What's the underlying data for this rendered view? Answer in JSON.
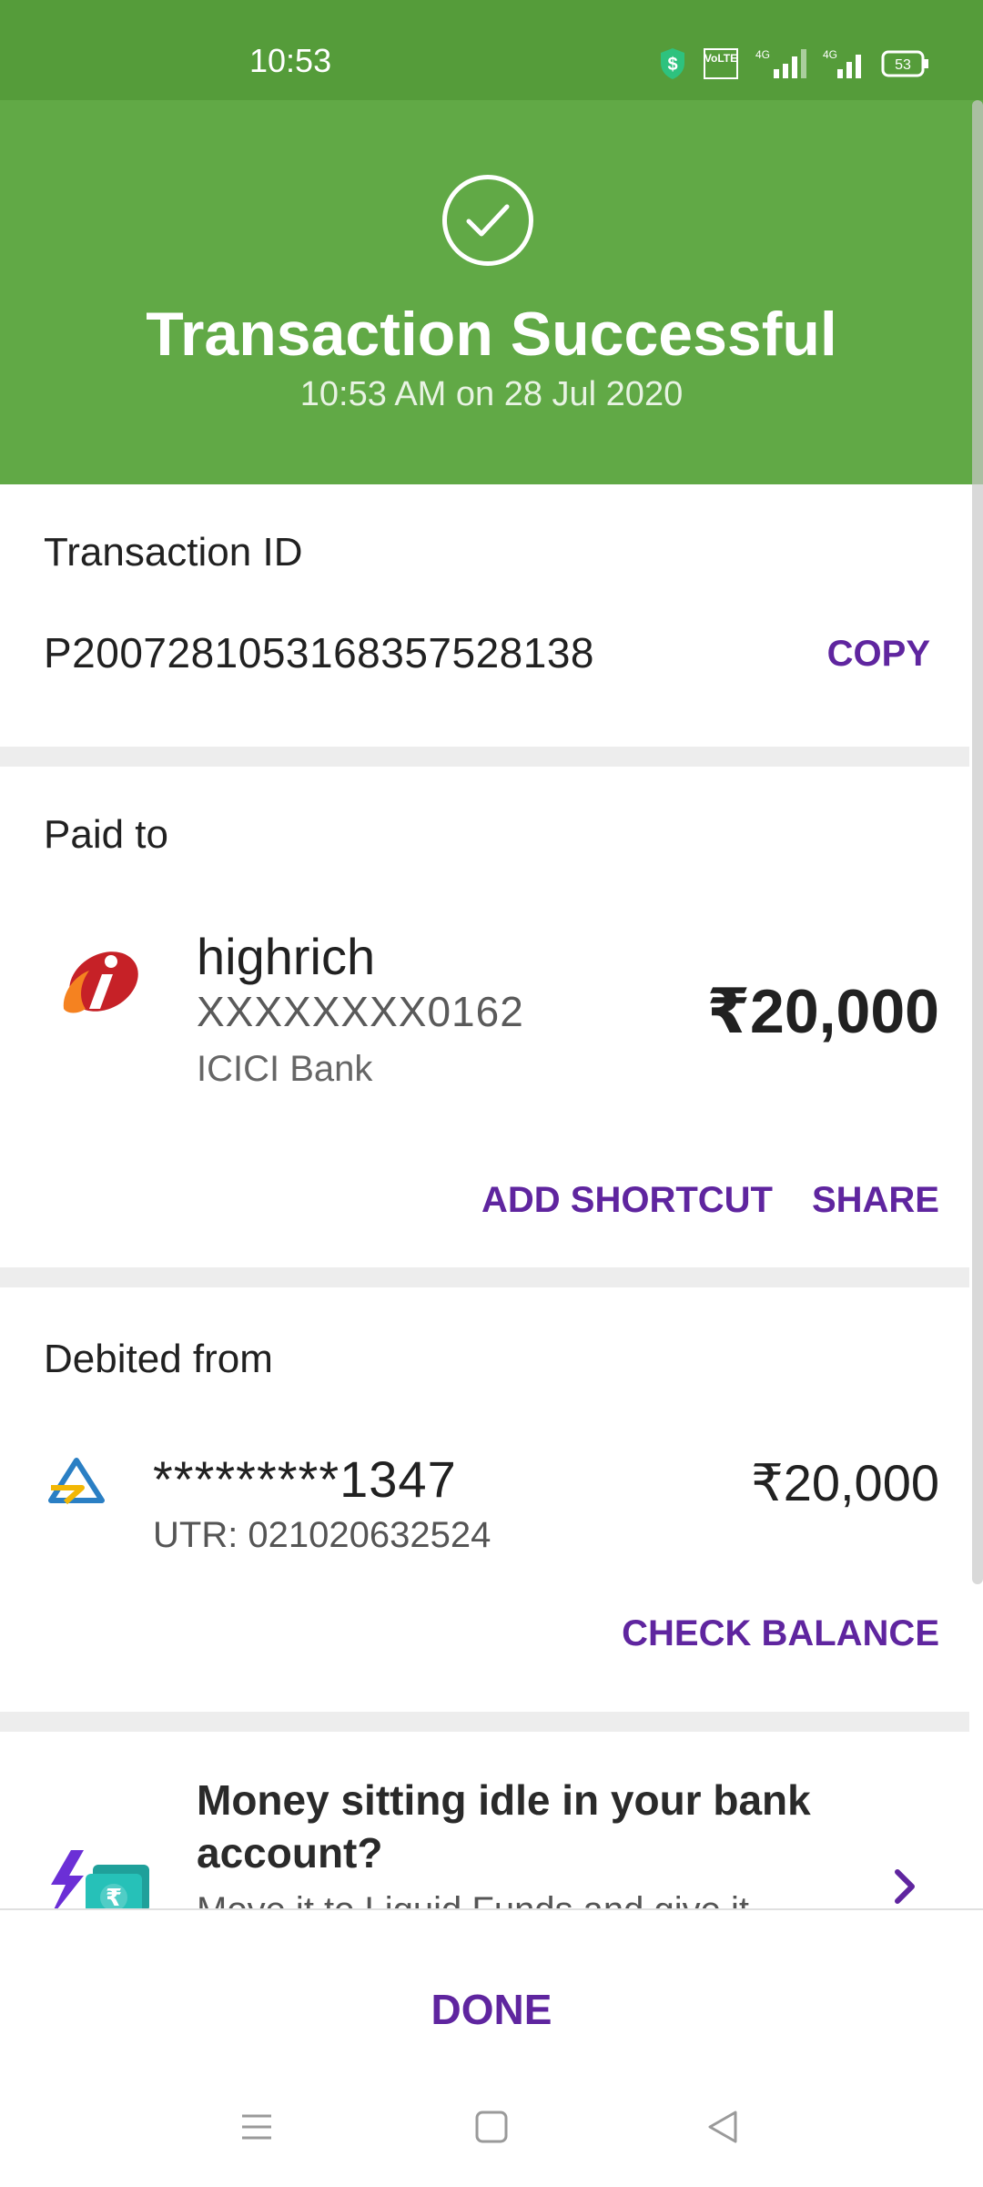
{
  "status_bar": {
    "time": "10:53",
    "battery": "53"
  },
  "header": {
    "title": "Transaction Successful",
    "subtitle": "10:53 AM on 28 Jul 2020"
  },
  "transaction": {
    "label": "Transaction ID",
    "id": "P2007281053168357528138",
    "copy_label": "COPY"
  },
  "paid_to": {
    "label": "Paid to",
    "name": "highrich",
    "account": "XXXXXXXX0162",
    "bank": "ICICI Bank",
    "amount": "₹20,000",
    "add_shortcut_label": "ADD SHORTCUT",
    "share_label": "SHARE"
  },
  "debited_from": {
    "label": "Debited from",
    "account": "*********1347",
    "utr": "UTR: 021020632524",
    "amount": "₹20,000",
    "check_balance_label": "CHECK BALANCE"
  },
  "promo": {
    "title": "Money sitting idle in your bank account?",
    "subtitle": "Move it to Liquid Funds and give it"
  },
  "bottom": {
    "done_label": "DONE"
  },
  "colors": {
    "header_green": "#61a946",
    "status_green": "#559c3a",
    "accent_purple": "#5f259f"
  },
  "icons": [
    "check-icon",
    "icici-logo",
    "sbi-logo",
    "promo-wallet-icon",
    "chevron-right-icon",
    "menu-icon",
    "home-icon",
    "back-icon"
  ]
}
